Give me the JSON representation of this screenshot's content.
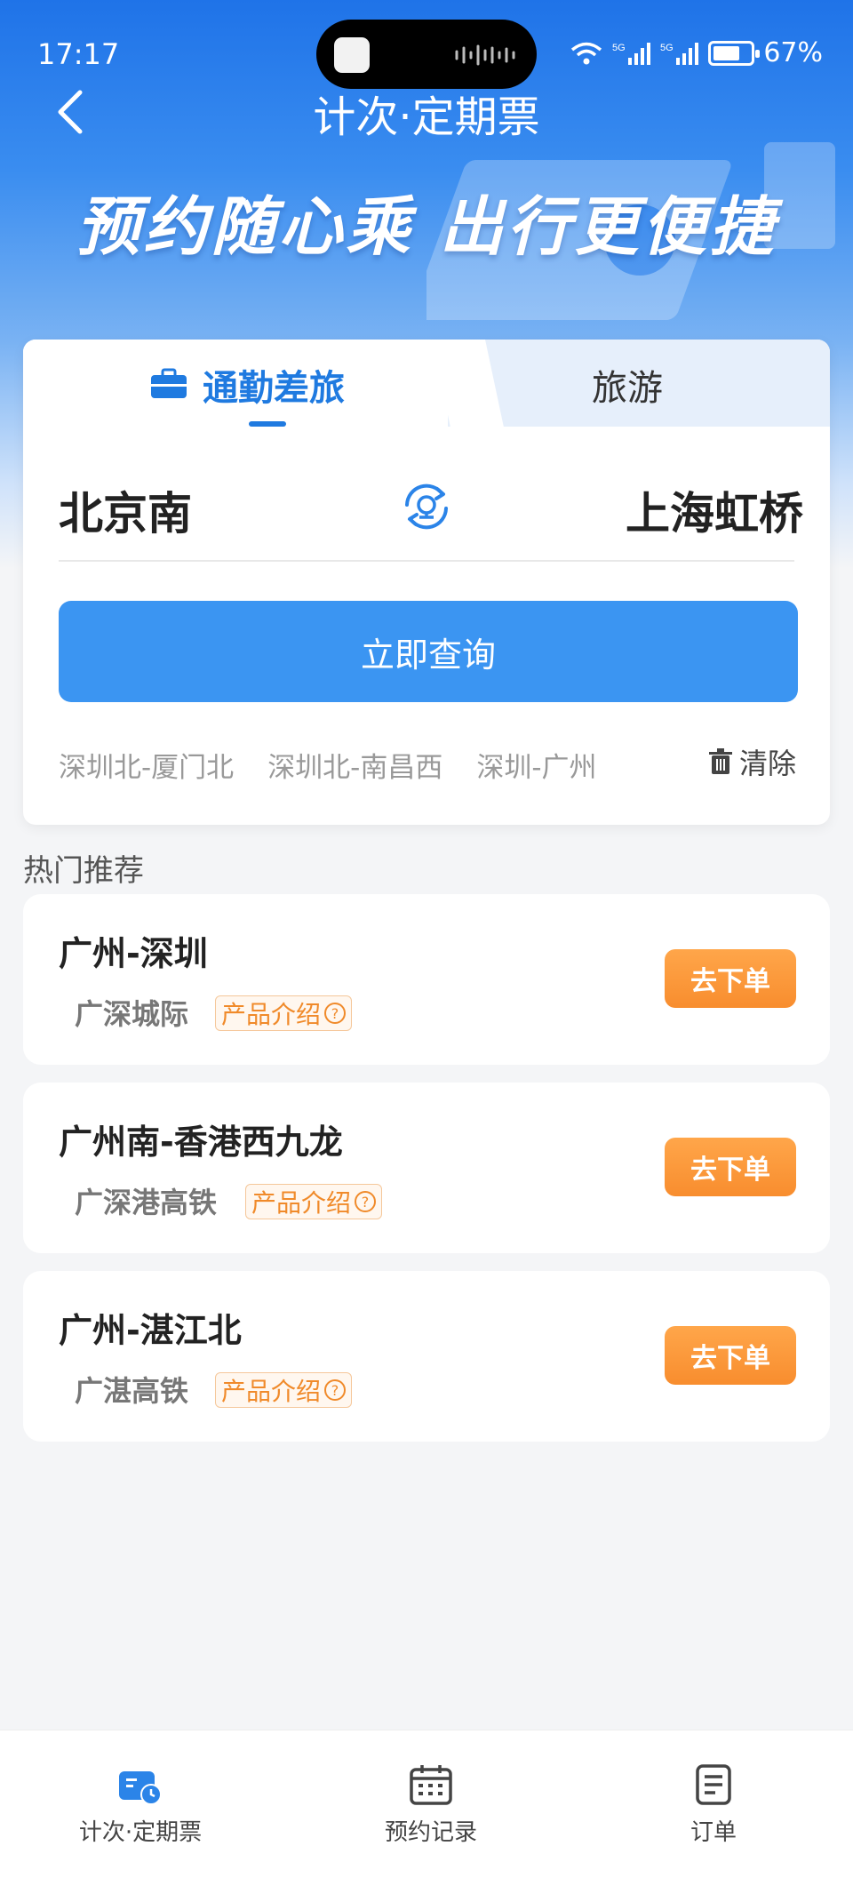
{
  "status_bar": {
    "time": "17:17",
    "battery": "67%"
  },
  "header": {
    "title": "计次·定期票",
    "slogan": "预约随心乘 出行更便捷"
  },
  "tabs": [
    {
      "label": "通勤差旅",
      "active": true
    },
    {
      "label": "旅游",
      "active": false
    }
  ],
  "route": {
    "from": "北京南",
    "to": "上海虹桥"
  },
  "search_button": "立即查询",
  "history": [
    "深圳北-厦门北",
    "深圳北-南昌西",
    "深圳-广州"
  ],
  "clear_label": "清除",
  "section_title": "热门推荐",
  "recommendations": [
    {
      "title": "广州-深圳",
      "subtitle": "广深城际",
      "tag": "产品介绍",
      "button": "去下单"
    },
    {
      "title": "广州南-香港西九龙",
      "subtitle": "广深港高铁",
      "tag": "产品介绍",
      "button": "去下单"
    },
    {
      "title": "广州-湛江北",
      "subtitle": "广湛高铁",
      "tag": "产品介绍",
      "button": "去下单"
    }
  ],
  "bottom_nav": [
    {
      "label": "计次·定期票",
      "icon": "ticket-icon",
      "active": true
    },
    {
      "label": "预约记录",
      "icon": "calendar-icon",
      "active": false
    },
    {
      "label": "订单",
      "icon": "document-icon",
      "active": false
    }
  ],
  "colors": {
    "primary": "#3b95f2",
    "accent": "#1f7ae0",
    "order": "#f88d2e"
  }
}
